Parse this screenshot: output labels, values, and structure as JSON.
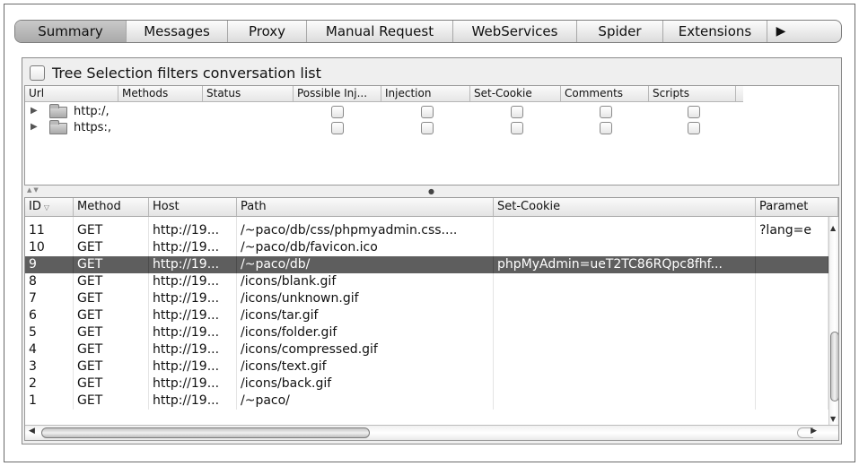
{
  "tabs": [
    {
      "label": "Summary",
      "selected": true
    },
    {
      "label": "Messages",
      "selected": false
    },
    {
      "label": "Proxy",
      "selected": false
    },
    {
      "label": "Manual Request",
      "selected": false
    },
    {
      "label": "WebServices",
      "selected": false
    },
    {
      "label": "Spider",
      "selected": false
    },
    {
      "label": "Extensions",
      "selected": false
    }
  ],
  "tab_more_icon": "right-triangle-icon",
  "filter": {
    "label": "Tree Selection filters conversation list",
    "checked": false
  },
  "tree": {
    "columns": [
      "Url",
      "Methods",
      "Status",
      "Possible Inj...",
      "Injection",
      "Set-Cookie",
      "Comments",
      "Scripts"
    ],
    "rows": [
      {
        "url": "http:/,",
        "icon": "folder-icon",
        "checks": [
          false,
          false,
          false,
          false,
          false
        ]
      },
      {
        "url": "https:,",
        "icon": "folder-icon",
        "checks": [
          false,
          false,
          false,
          false,
          false
        ]
      }
    ]
  },
  "table": {
    "columns": [
      "ID",
      "Method",
      "Host",
      "Path",
      "Set-Cookie",
      "Paramet"
    ],
    "sorted_column": "ID",
    "rows": [
      {
        "id": "11",
        "method": "GET",
        "host": "http://19...",
        "path": "/~paco/db/css/phpmyadmin.css....",
        "cookie": "",
        "params": "?lang=e",
        "selected": false
      },
      {
        "id": "10",
        "method": "GET",
        "host": "http://19...",
        "path": "/~paco/db/favicon.ico",
        "cookie": "",
        "params": "",
        "selected": false
      },
      {
        "id": "9",
        "method": "GET",
        "host": "http://19...",
        "path": "/~paco/db/",
        "cookie": "phpMyAdmin=ueT2TC86RQpc8fhf...",
        "params": "",
        "selected": true
      },
      {
        "id": "8",
        "method": "GET",
        "host": "http://19...",
        "path": "/icons/blank.gif",
        "cookie": "",
        "params": "",
        "selected": false
      },
      {
        "id": "7",
        "method": "GET",
        "host": "http://19...",
        "path": "/icons/unknown.gif",
        "cookie": "",
        "params": "",
        "selected": false
      },
      {
        "id": "6",
        "method": "GET",
        "host": "http://19...",
        "path": "/icons/tar.gif",
        "cookie": "",
        "params": "",
        "selected": false
      },
      {
        "id": "5",
        "method": "GET",
        "host": "http://19...",
        "path": "/icons/folder.gif",
        "cookie": "",
        "params": "",
        "selected": false
      },
      {
        "id": "4",
        "method": "GET",
        "host": "http://19...",
        "path": "/icons/compressed.gif",
        "cookie": "",
        "params": "",
        "selected": false
      },
      {
        "id": "3",
        "method": "GET",
        "host": "http://19...",
        "path": "/icons/text.gif",
        "cookie": "",
        "params": "",
        "selected": false
      },
      {
        "id": "2",
        "method": "GET",
        "host": "http://19...",
        "path": "/icons/back.gif",
        "cookie": "",
        "params": "",
        "selected": false
      },
      {
        "id": "1",
        "method": "GET",
        "host": "http://19...",
        "path": "/~paco/",
        "cookie": "",
        "params": "",
        "selected": false
      }
    ]
  }
}
